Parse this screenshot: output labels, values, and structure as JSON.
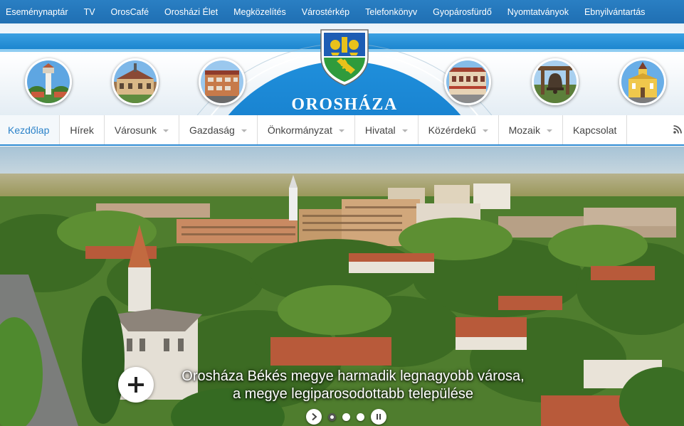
{
  "topbar": {
    "links": [
      "Eseménynaptár",
      "TV",
      "OrosCafé",
      "Orosházi Élet",
      "Megközelítés",
      "Várostérkép",
      "Telefonkönyv",
      "Gyopárosfürdő",
      "Nyomtatványok",
      "Ebnyilvántartás"
    ]
  },
  "header": {
    "town_name": "OROSHÁZA",
    "crest_icon": "coat-of-arms-icon",
    "photo_icons": [
      "water-tower-photo",
      "town-hall-photo",
      "building-photo",
      "street-photo",
      "bell-photo",
      "church-photo"
    ]
  },
  "nav": {
    "items": [
      {
        "label": "Kezdőlap",
        "dropdown": false,
        "active": true
      },
      {
        "label": "Hírek",
        "dropdown": false,
        "active": false
      },
      {
        "label": "Városunk",
        "dropdown": true,
        "active": false
      },
      {
        "label": "Gazdaság",
        "dropdown": true,
        "active": false
      },
      {
        "label": "Önkormányzat",
        "dropdown": true,
        "active": false
      },
      {
        "label": "Hivatal",
        "dropdown": true,
        "active": false
      },
      {
        "label": "Közérdekű",
        "dropdown": true,
        "active": false
      },
      {
        "label": "Mozaik",
        "dropdown": true,
        "active": false
      },
      {
        "label": "Kapcsolat",
        "dropdown": false,
        "active": false
      }
    ],
    "rss_icon": "rss-icon"
  },
  "hero": {
    "caption_line1": "Orosháza Békés megye harmadik legnagyobb városa,",
    "caption_line2": "a megye legiparosodottabb települése",
    "plus_icon": "plus-icon",
    "prev_icon": "chevron-right-icon",
    "pause_icon": "pause-icon",
    "slide_count": 3,
    "active_slide": 1
  },
  "colors": {
    "brand_blue": "#1f6fb3",
    "accent_blue": "#2b82c9",
    "nav_text": "#444444"
  }
}
